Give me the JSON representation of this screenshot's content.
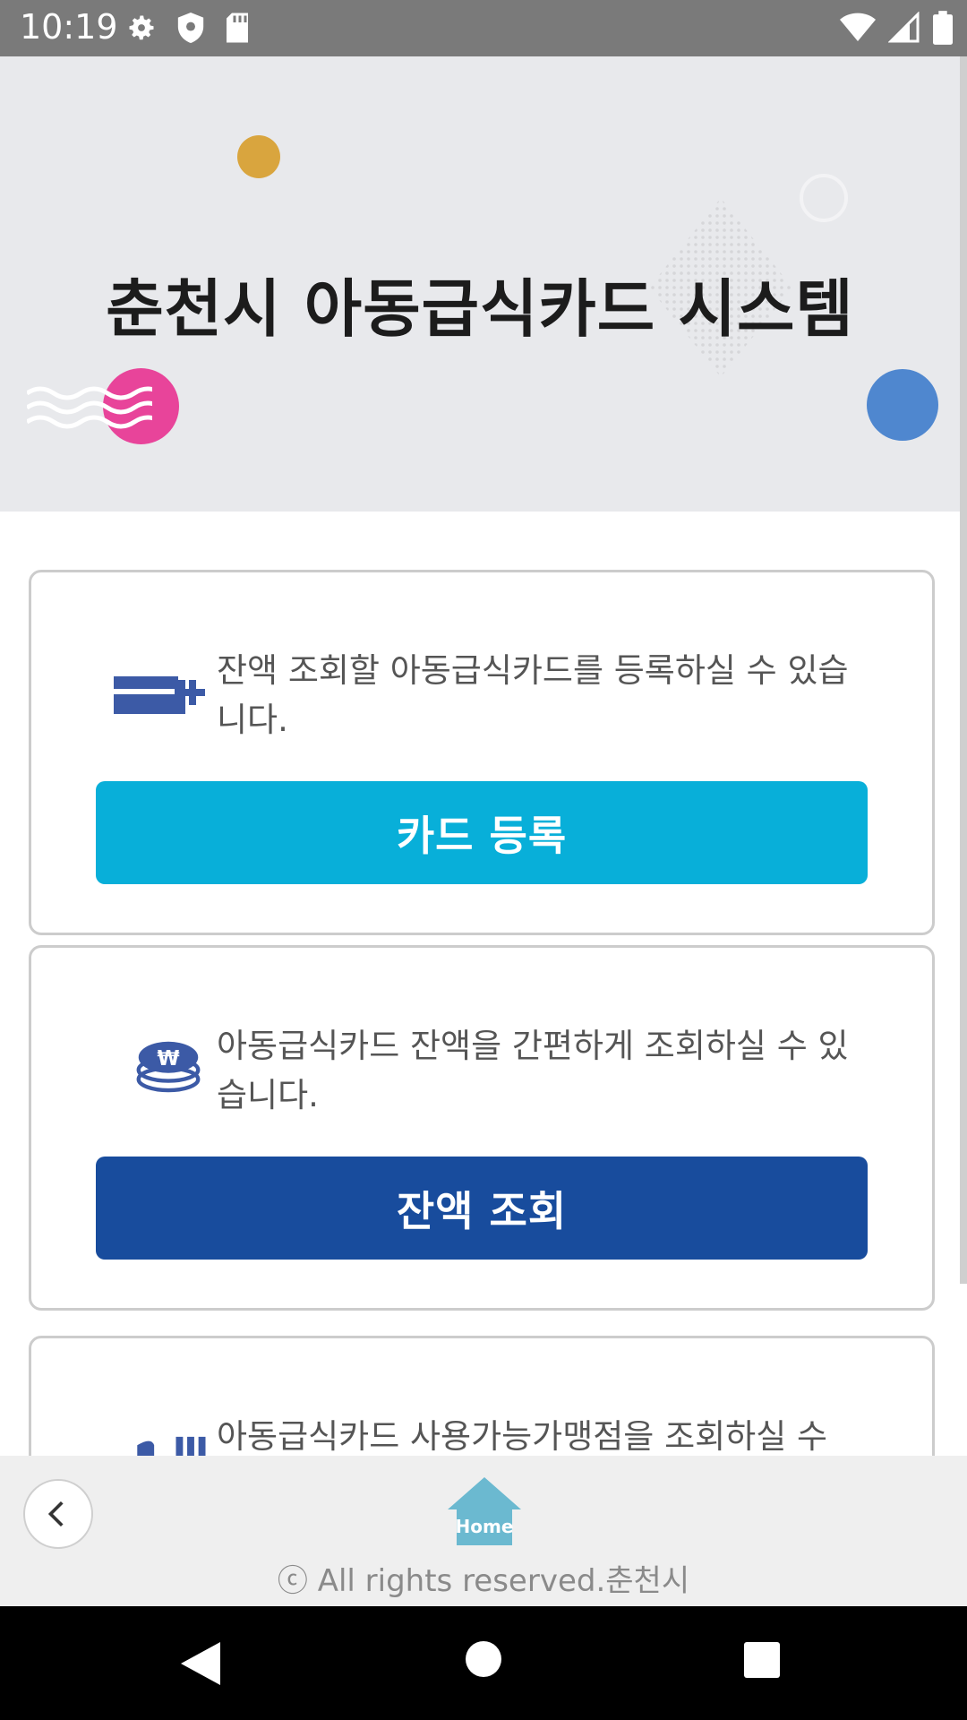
{
  "status_bar": {
    "time": "10:19",
    "left_icons": [
      "gear-icon",
      "shield-icon",
      "sd-card-icon"
    ],
    "right_icons": [
      "wifi-icon",
      "signal-icon",
      "battery-icon"
    ]
  },
  "hero": {
    "title": "춘천시 아동급식카드 시스템",
    "colors": {
      "background": "#e8e9ec",
      "yellow_dot": "#d9a53e",
      "pink_dot": "#e8449a",
      "blue_dot": "#4f87cf"
    }
  },
  "cards": [
    {
      "icon": "card-add-icon",
      "description": "잔액 조회할 아동급식카드를 등록하실 수 있습니다.",
      "button_label": "카드 등록",
      "button_color": "#08afd9"
    },
    {
      "icon": "coins-won-icon",
      "description": "아동급식카드 잔액을 간편하게 조회하실 수 있습니다.",
      "button_label": "잔액 조회",
      "button_color": "#184c9d"
    },
    {
      "icon": "utensils-icon",
      "description": "아동급식카드 사용가능가맹점을 조회하실 수"
    }
  ],
  "footer": {
    "back_icon": "chevron-left-icon",
    "home_label": "Home",
    "copyright": "ⓒ All rights reserved.춘천시"
  },
  "nav_bar": {
    "icons": [
      "nav-back-icon",
      "nav-home-icon",
      "nav-recents-icon"
    ]
  }
}
